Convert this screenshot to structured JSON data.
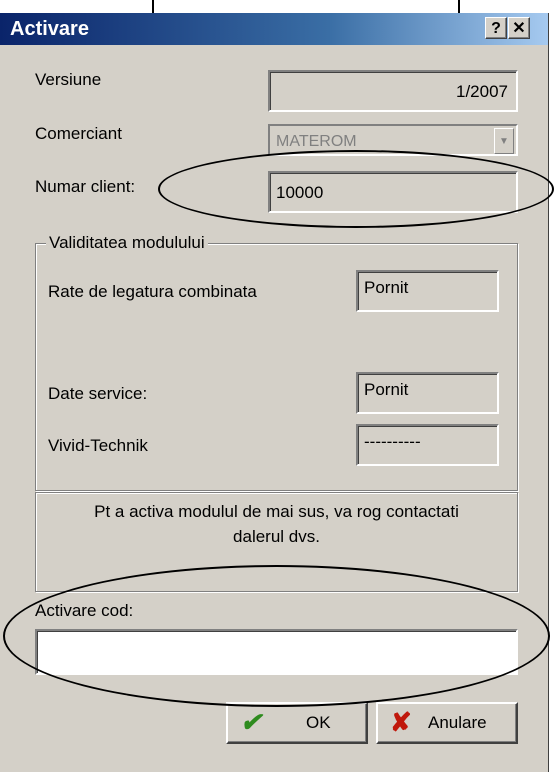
{
  "window": {
    "title": "Activare",
    "help_label": "?",
    "close_label": "✕"
  },
  "fields": {
    "versiune_label": "Versiune",
    "versiune_value": "1/2007",
    "comerciant_label": "Comerciant",
    "comerciant_value": "MATEROM",
    "numar_client_label": "Numar client:",
    "numar_client_value": "10000"
  },
  "group": {
    "legend": "Validitatea modulului",
    "items": [
      {
        "label": "Rate de legatura combinata",
        "value": "Pornit"
      },
      {
        "label": "Date service:",
        "value": "Pornit"
      },
      {
        "label": "Vivid-Technik",
        "value": "----------"
      }
    ]
  },
  "info": {
    "line1": "Pt a activa modulul de mai sus, va rog contactati",
    "line2": "dalerul dvs."
  },
  "activation": {
    "label": "Activare cod:",
    "value": ""
  },
  "buttons": {
    "ok_label": "OK",
    "cancel_label": "Anulare"
  },
  "icons": {
    "ok": "check-icon",
    "cancel": "x-icon",
    "dropdown": "chevron-down-icon"
  },
  "colors": {
    "titlebar": "#0a246a",
    "window_bg": "#d4d0c8",
    "ok_icon": "#2e8b1e",
    "cancel_icon": "#c0180c"
  }
}
